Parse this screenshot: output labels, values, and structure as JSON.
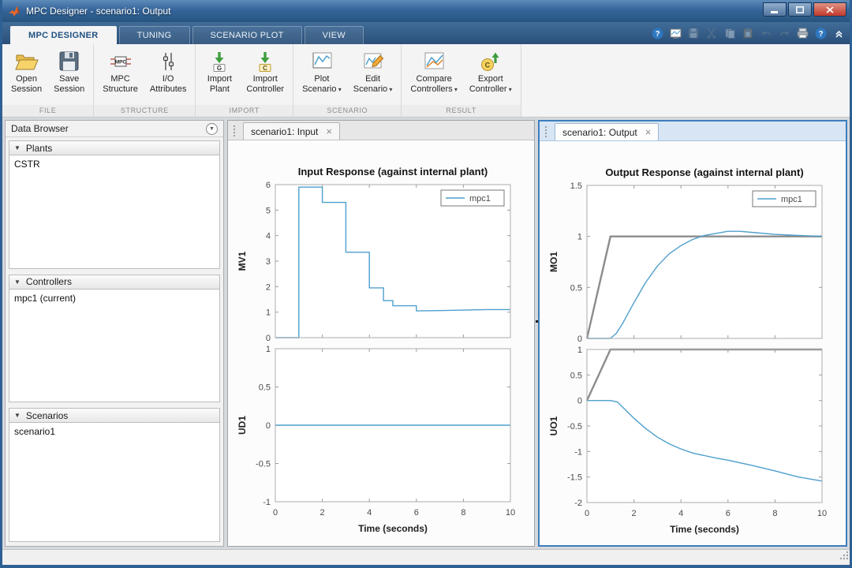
{
  "window": {
    "title": "MPC Designer - scenario1: Output"
  },
  "ribbon_tabs": [
    {
      "label": "MPC DESIGNER",
      "active": true
    },
    {
      "label": "TUNING",
      "active": false
    },
    {
      "label": "SCENARIO PLOT",
      "active": false
    },
    {
      "label": "VIEW",
      "active": false
    }
  ],
  "quick_access": [
    {
      "name": "help",
      "disabled": false
    },
    {
      "name": "snapshot",
      "disabled": false
    },
    {
      "name": "save",
      "disabled": true
    },
    {
      "name": "cut",
      "disabled": true
    },
    {
      "name": "copy",
      "disabled": true
    },
    {
      "name": "paste",
      "disabled": true
    },
    {
      "name": "undo",
      "disabled": true
    },
    {
      "name": "redo",
      "disabled": true
    },
    {
      "name": "print",
      "disabled": false
    },
    {
      "name": "help-2",
      "disabled": false
    },
    {
      "name": "collapse-ribbon",
      "disabled": false
    }
  ],
  "ribbon_groups": [
    {
      "label": "FILE",
      "buttons": [
        {
          "name": "open-session",
          "icon": "folder-open",
          "lines": [
            "Open",
            "Session"
          ],
          "dropdown": false
        },
        {
          "name": "save-session",
          "icon": "save-big",
          "lines": [
            "Save",
            "Session"
          ],
          "dropdown": false
        }
      ]
    },
    {
      "label": "STRUCTURE",
      "buttons": [
        {
          "name": "mpc-structure",
          "icon": "mpc-structure",
          "lines": [
            "MPC",
            "Structure"
          ],
          "dropdown": false
        },
        {
          "name": "io-attributes",
          "icon": "io-attributes",
          "lines": [
            "I/O",
            "Attributes"
          ],
          "dropdown": false
        }
      ]
    },
    {
      "label": "IMPORT",
      "buttons": [
        {
          "name": "import-plant",
          "icon": "import-plant",
          "lines": [
            "Import",
            "Plant"
          ],
          "dropdown": false
        },
        {
          "name": "import-controller",
          "icon": "import-controller",
          "lines": [
            "Import",
            "Controller"
          ],
          "dropdown": false
        }
      ]
    },
    {
      "label": "SCENARIO",
      "buttons": [
        {
          "name": "plot-scenario",
          "icon": "plot-scenario",
          "lines": [
            "Plot",
            "Scenario"
          ],
          "dropdown": true
        },
        {
          "name": "edit-scenario",
          "icon": "edit-scenario",
          "lines": [
            "Edit",
            "Scenario"
          ],
          "dropdown": true
        }
      ]
    },
    {
      "label": "RESULT",
      "buttons": [
        {
          "name": "compare-controllers",
          "icon": "compare-controllers",
          "lines": [
            "Compare",
            "Controllers"
          ],
          "dropdown": true
        },
        {
          "name": "export-controller",
          "icon": "export-controller",
          "lines": [
            "Export",
            "Controller"
          ],
          "dropdown": true
        }
      ]
    }
  ],
  "data_browser": {
    "title": "Data Browser",
    "sections": [
      {
        "label": "Plants",
        "items": [
          "CSTR"
        ]
      },
      {
        "label": "Controllers",
        "items": [
          "mpc1 (current)"
        ]
      },
      {
        "label": "Scenarios",
        "items": [
          "scenario1"
        ]
      }
    ]
  },
  "documents": [
    {
      "tab": "scenario1: Input",
      "active": false,
      "chart": 0
    },
    {
      "tab": "scenario1: Output",
      "active": true,
      "chart": 1
    }
  ],
  "colors": {
    "mpc_line": "#4e9fcc",
    "reference_line": "#8c8c8c",
    "focus_border": "#3e7dbd"
  },
  "chart_data": [
    {
      "type": "line",
      "title": "Input Response (against internal plant)",
      "xlabel": "Time (seconds)",
      "xlim": [
        0,
        10
      ],
      "xticks": [
        0,
        2,
        4,
        6,
        8,
        10
      ],
      "legend": [
        {
          "label": "mpc1",
          "color": "#4e9fcc"
        }
      ],
      "subplots": [
        {
          "ylabel": "MV1",
          "ylim": [
            0,
            6
          ],
          "yticks": [
            0,
            1,
            2,
            3,
            4,
            5,
            6
          ],
          "show_legend": true,
          "series": [
            {
              "name": "mpc1",
              "color": "#4e9fcc",
              "width": 1.4,
              "x": [
                0,
                1,
                1,
                2,
                2,
                3,
                3,
                4,
                4,
                4.6,
                4.6,
                5,
                5,
                6,
                6,
                7,
                8,
                9,
                10
              ],
              "y": [
                0,
                0,
                5.9,
                5.9,
                5.3,
                5.3,
                3.35,
                3.35,
                1.95,
                1.95,
                1.45,
                1.45,
                1.25,
                1.25,
                1.05,
                1.06,
                1.08,
                1.1,
                1.1
              ]
            }
          ]
        },
        {
          "ylabel": "UD1",
          "ylim": [
            -1,
            1
          ],
          "yticks": [
            -1,
            -0.5,
            0,
            0.5,
            1
          ],
          "show_legend": false,
          "series": [
            {
              "name": "mpc1",
              "color": "#4e9fcc",
              "width": 1.4,
              "x": [
                0,
                10
              ],
              "y": [
                0,
                0
              ]
            }
          ]
        }
      ]
    },
    {
      "type": "line",
      "title": "Output Response (against internal plant)",
      "xlabel": "Time (seconds)",
      "xlim": [
        0,
        10
      ],
      "xticks": [
        0,
        2,
        4,
        6,
        8,
        10
      ],
      "legend": [
        {
          "label": "mpc1",
          "color": "#4e9fcc"
        }
      ],
      "subplots": [
        {
          "ylabel": "MO1",
          "ylim": [
            0,
            1.5
          ],
          "yticks": [
            0,
            0.5,
            1,
            1.5
          ],
          "show_legend": true,
          "series": [
            {
              "name": "reference",
              "color": "#8c8c8c",
              "width": 2.4,
              "x": [
                0,
                1,
                10
              ],
              "y": [
                0,
                1,
                1
              ]
            },
            {
              "name": "mpc1",
              "color": "#4e9fcc",
              "width": 1.4,
              "x": [
                0,
                1,
                1.25,
                1.5,
                2,
                2.5,
                3,
                3.5,
                4,
                4.5,
                5,
                5.5,
                6,
                6.5,
                7,
                8,
                9,
                10
              ],
              "y": [
                0,
                0,
                0.05,
                0.14,
                0.35,
                0.55,
                0.71,
                0.83,
                0.91,
                0.97,
                1.01,
                1.03,
                1.05,
                1.05,
                1.04,
                1.02,
                1.01,
                1.0
              ]
            }
          ]
        },
        {
          "ylabel": "UO1",
          "ylim": [
            -2,
            1
          ],
          "yticks": [
            -2,
            -1.5,
            -1,
            -0.5,
            0,
            0.5,
            1
          ],
          "show_legend": false,
          "series": [
            {
              "name": "reference",
              "color": "#8c8c8c",
              "width": 2.4,
              "x": [
                0,
                1,
                10
              ],
              "y": [
                0,
                1,
                1
              ]
            },
            {
              "name": "mpc1",
              "color": "#4e9fcc",
              "width": 1.4,
              "x": [
                0,
                1,
                1.3,
                2,
                2.5,
                3,
                3.5,
                4,
                4.5,
                5,
                5.5,
                6,
                7,
                8,
                9,
                10
              ],
              "y": [
                0,
                0,
                -0.03,
                -0.35,
                -0.55,
                -0.72,
                -0.85,
                -0.95,
                -1.03,
                -1.08,
                -1.13,
                -1.17,
                -1.27,
                -1.38,
                -1.5,
                -1.58
              ]
            }
          ]
        }
      ]
    }
  ]
}
